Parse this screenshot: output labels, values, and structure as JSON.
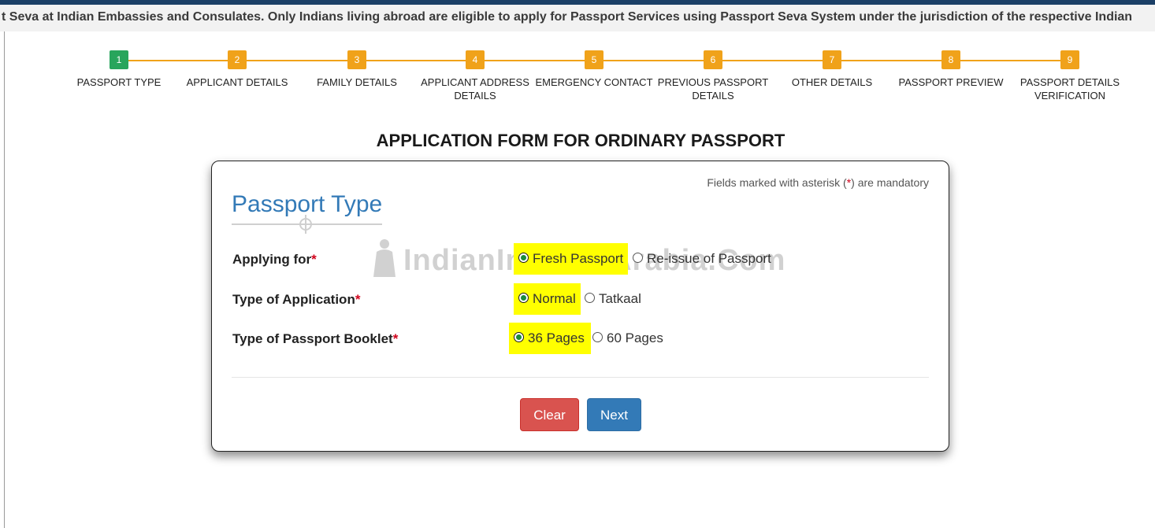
{
  "marquee": {
    "text": "t Seva at Indian Embassies and Consulates. Only Indians living abroad are eligible to apply for Passport Services using Passport Seva System under the jurisdiction of the respective Indian"
  },
  "steps": [
    {
      "num": "1",
      "label": "PASSPORT TYPE",
      "active": true
    },
    {
      "num": "2",
      "label": "APPLICANT DETAILS"
    },
    {
      "num": "3",
      "label": "FAMILY DETAILS"
    },
    {
      "num": "4",
      "label": "APPLICANT ADDRESS DETAILS"
    },
    {
      "num": "5",
      "label": "EMERGENCY CONTACT"
    },
    {
      "num": "6",
      "label": "PREVIOUS PASSPORT DETAILS"
    },
    {
      "num": "7",
      "label": "OTHER DETAILS"
    },
    {
      "num": "8",
      "label": "PASSPORT PREVIEW"
    },
    {
      "num": "9",
      "label": "PASSPORT DETAILS VERIFICATION"
    }
  ],
  "page_title": "APPLICATION FORM FOR ORDINARY PASSPORT",
  "card": {
    "mandatory_prefix": "Fields marked with asterisk (",
    "mandatory_asterisk": "*",
    "mandatory_suffix": ") are mandatory",
    "section_title": "Passport Type",
    "watermark_text": "IndianInSaudiArabia.Com",
    "required_marker": "*",
    "fields": {
      "applying_for": {
        "label": "Applying for",
        "options": [
          "Fresh Passport",
          "Re-issue of Passport"
        ],
        "selected": "Fresh Passport"
      },
      "application_type": {
        "label": "Type of Application",
        "options": [
          "Normal",
          "Tatkaal"
        ],
        "selected": "Normal"
      },
      "booklet": {
        "label": "Type of Passport Booklet",
        "options": [
          "36 Pages",
          "60 Pages"
        ],
        "selected": "36 Pages"
      }
    },
    "buttons": {
      "clear": "Clear",
      "next": "Next"
    }
  },
  "colors": {
    "step_active": "#28a55c",
    "step_pending": "#f0a21a",
    "title_blue": "#337ab7",
    "clear_button": "#d9534f",
    "next_button": "#337ab7",
    "highlight": "#ffff00"
  }
}
